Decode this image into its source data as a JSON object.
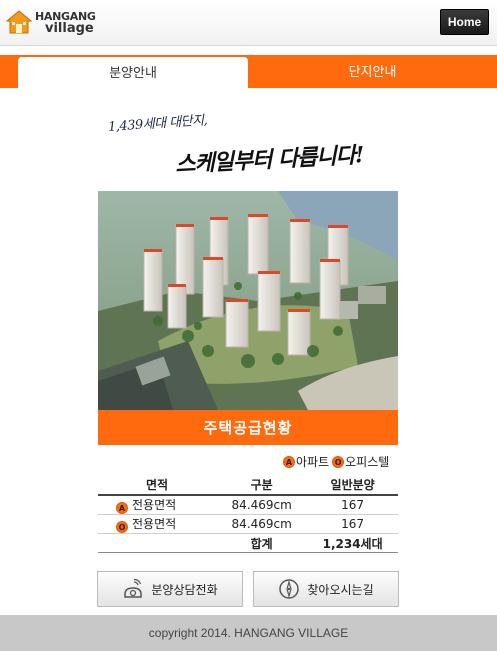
{
  "header": {
    "logo_line1": "HANGANG",
    "logo_line2": "village",
    "home_label": "Home"
  },
  "tabs": [
    {
      "label": "분양안내",
      "active": true
    },
    {
      "label": "단지안내",
      "active": false
    }
  ],
  "slogan": {
    "line1": "1,439세대 대단지,",
    "line2": "스케일부터 다릅니다!"
  },
  "banner": "주택공급현황",
  "legend": {
    "apt_badge": "A",
    "apt_label": "아파트",
    "office_badge": "O",
    "office_label": "오피스텔"
  },
  "table": {
    "headers": [
      "면적",
      "구분",
      "일반분양"
    ],
    "rows": [
      {
        "badge": "A",
        "area": "전용면적",
        "type": "84.469cm",
        "count": "167"
      },
      {
        "badge": "O",
        "area": "전용면적",
        "type": "84.469cm",
        "count": "167"
      }
    ],
    "total_label": "합계",
    "total_value": "1,234세대"
  },
  "buttons": {
    "call_label": "분양상담전화",
    "directions_label": "찾아오시는길"
  },
  "footer": "copyright 2014. HANGANG VILLAGE",
  "colors": {
    "accent": "#ff6a0e",
    "footer_bg": "#c8c8c8"
  }
}
